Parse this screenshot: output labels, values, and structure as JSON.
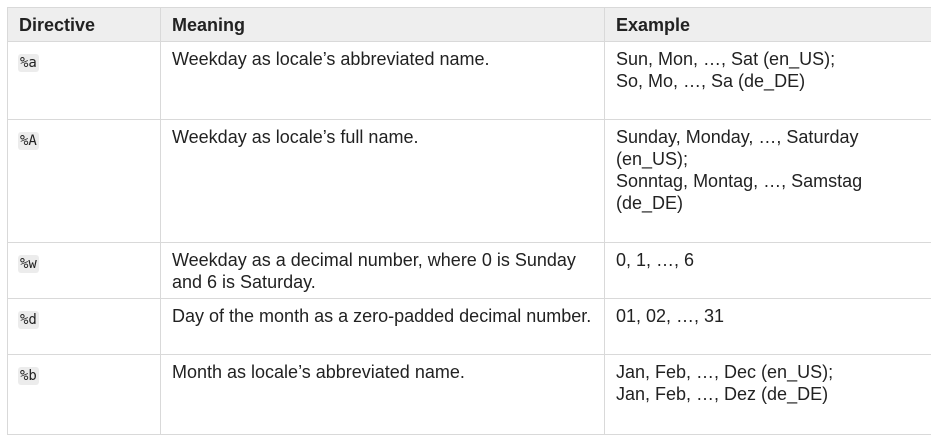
{
  "table": {
    "headers": {
      "directive": "Directive",
      "meaning": "Meaning",
      "example": "Example"
    },
    "rows": [
      {
        "directive": "%a",
        "meaning": "Weekday as locale’s abbreviated name.",
        "example": [
          "Sun, Mon, …, Sat (en_US);",
          "So, Mo, …, Sa (de_DE)"
        ]
      },
      {
        "directive": "%A",
        "meaning": "Weekday as locale’s full name.",
        "example": [
          "Sunday, Monday, …, Saturday",
          "(en_US);",
          "Sonntag, Montag, …, Samstag",
          "(de_DE)"
        ]
      },
      {
        "directive": "%w",
        "meaning": "Weekday as a decimal number, where 0 is Sunday and 6 is Saturday.",
        "example": [
          "0, 1, …, 6"
        ]
      },
      {
        "directive": "%d",
        "meaning": "Day of the month as a zero-padded decimal number.",
        "example": [
          "01, 02, …, 31"
        ]
      },
      {
        "directive": "%b",
        "meaning": "Month as locale’s abbreviated name.",
        "example": [
          "Jan, Feb, …, Dec (en_US);",
          "Jan, Feb, …, Dez (de_DE)"
        ]
      }
    ]
  }
}
